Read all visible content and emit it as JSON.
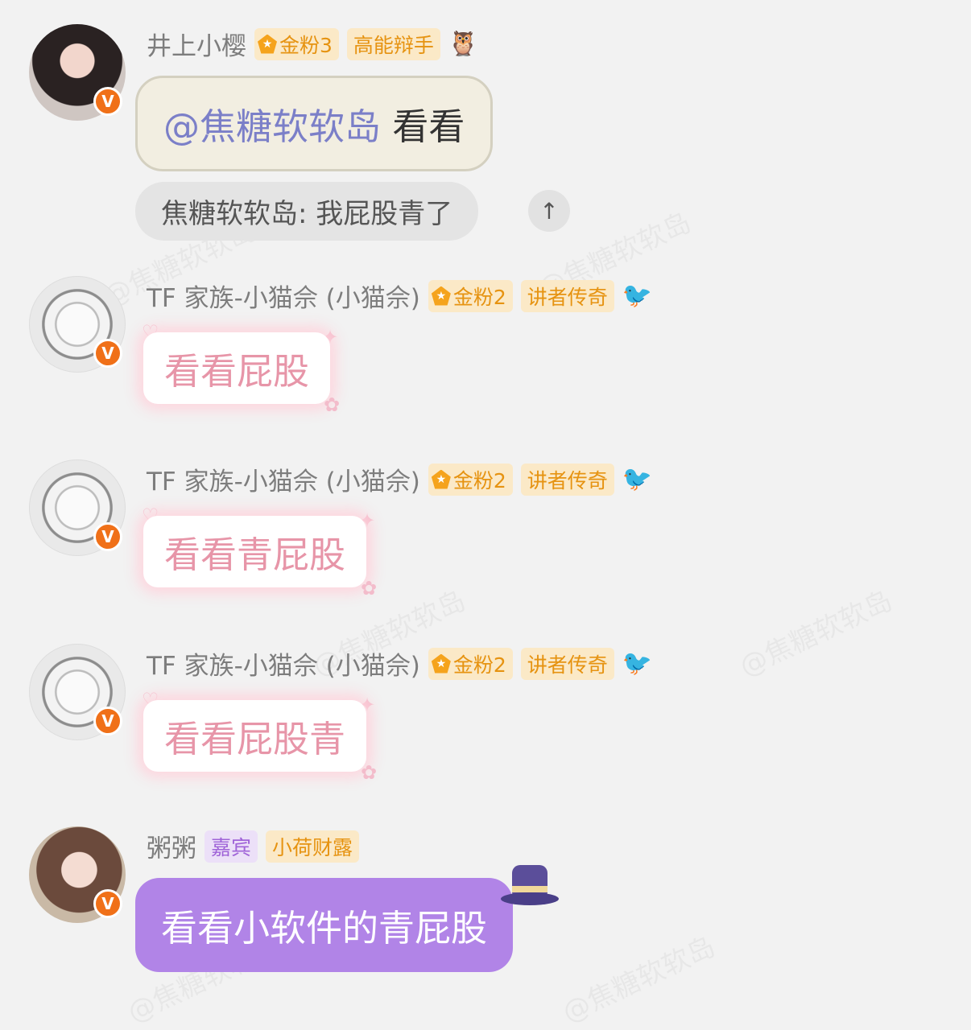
{
  "watermark": "@焦糖软软岛",
  "messages": [
    {
      "username": "井上小樱",
      "fan_badge": "金粉3",
      "title_badge": "高能辩手",
      "deco_icon": "🦉",
      "mention": "@焦糖软软岛",
      "text": "看看",
      "reply_quote": "焦糖软软岛: 我屁股青了",
      "reply_icon": "↑"
    },
    {
      "username": "TF 家族-小猫佘 (小猫佘)",
      "fan_badge": "金粉2",
      "title_badge": "讲者传奇",
      "deco_icon": "🐦",
      "text": "看看屁股"
    },
    {
      "username": "TF 家族-小猫佘 (小猫佘)",
      "fan_badge": "金粉2",
      "title_badge": "讲者传奇",
      "deco_icon": "🐦",
      "text": "看看青屁股"
    },
    {
      "username": "TF 家族-小猫佘 (小猫佘)",
      "fan_badge": "金粉2",
      "title_badge": "讲者传奇",
      "deco_icon": "🐦",
      "text": "看看屁股青"
    },
    {
      "username": "粥粥",
      "guest_badge": "嘉宾",
      "title_badge": "小荷财露",
      "text": "看看小软件的青屁股"
    }
  ],
  "vip_badge_letter": "V",
  "colors": {
    "background": "#f2f2f2",
    "username": "#7d7d7d",
    "gold_badge": "#e69311",
    "mention": "#7b7fc8",
    "pink_text": "#e795a8",
    "purple_bubble": "#b184e7"
  }
}
